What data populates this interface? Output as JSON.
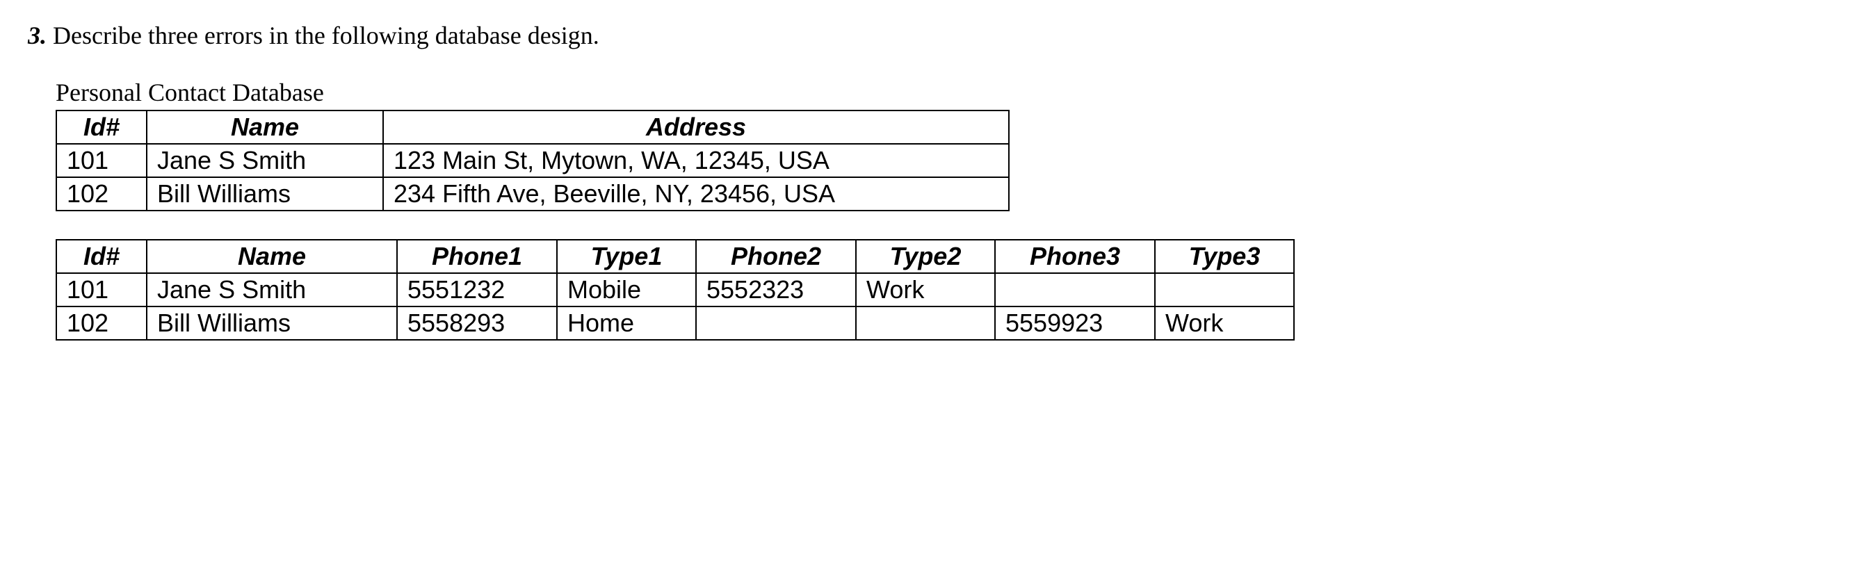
{
  "question": {
    "number": "3.",
    "text": "Describe three errors in the following database design."
  },
  "dbTitle": "Personal Contact Database",
  "table1": {
    "headers": {
      "id": "Id#",
      "name": "Name",
      "address": "Address"
    },
    "rows": [
      {
        "id": "101",
        "name": "Jane S Smith",
        "address": "123 Main St, Mytown, WA, 12345, USA"
      },
      {
        "id": "102",
        "name": "Bill Williams",
        "address": "234 Fifth Ave, Beeville, NY, 23456, USA"
      }
    ]
  },
  "table2": {
    "headers": {
      "id": "Id#",
      "name": "Name",
      "phone1": "Phone1",
      "type1": "Type1",
      "phone2": "Phone2",
      "type2": "Type2",
      "phone3": "Phone3",
      "type3": "Type3"
    },
    "rows": [
      {
        "id": "101",
        "name": "Jane S Smith",
        "phone1": "5551232",
        "type1": "Mobile",
        "phone2": "5552323",
        "type2": "Work",
        "phone3": "",
        "type3": ""
      },
      {
        "id": "102",
        "name": "Bill Williams",
        "phone1": "5558293",
        "type1": "Home",
        "phone2": "",
        "type2": "",
        "phone3": "5559923",
        "type3": "Work"
      }
    ]
  }
}
